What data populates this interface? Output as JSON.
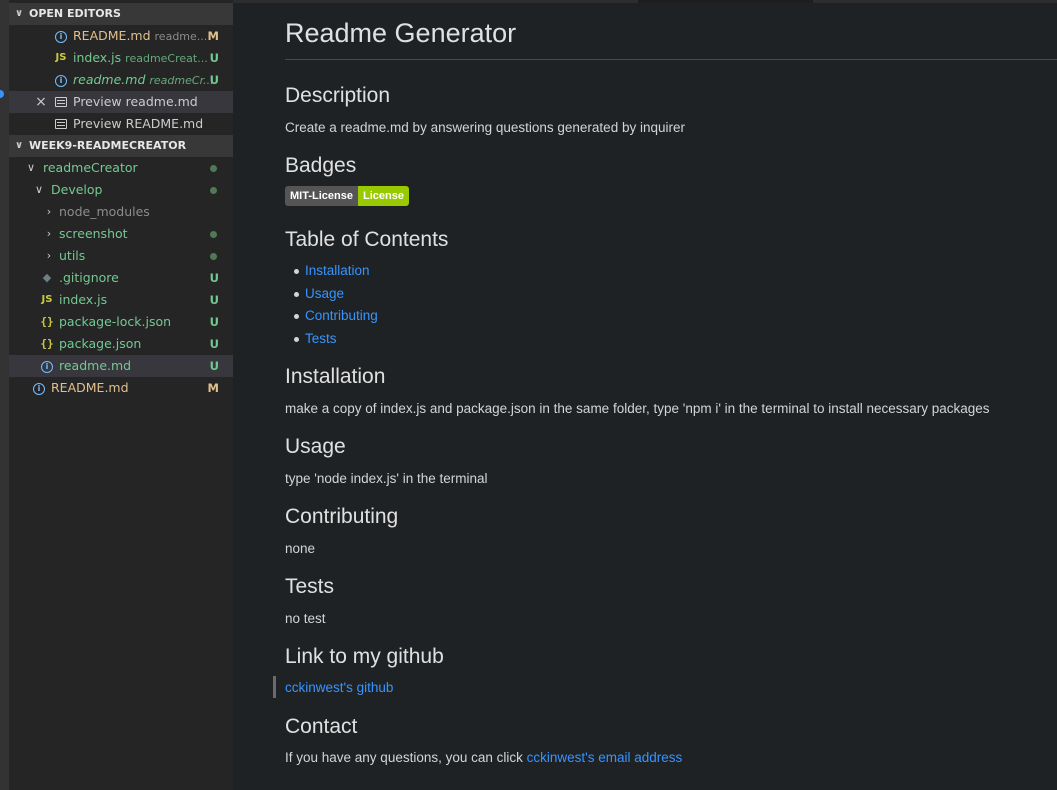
{
  "sidebar": {
    "open_editors": {
      "title": "OPEN EDITORS",
      "items": [
        {
          "icon": "info-icon",
          "name": "README.md",
          "desc": "readme...",
          "badge": "M"
        },
        {
          "icon": "js-icon",
          "name": "index.js",
          "desc": "readmeCreat...",
          "badge": "U"
        },
        {
          "icon": "info-icon",
          "name": "readme.md",
          "desc": "readmeCr...",
          "badge": "U"
        },
        {
          "icon": "preview-icon",
          "name": "Preview readme.md",
          "close": "×"
        },
        {
          "icon": "preview-icon",
          "name": "Preview README.md"
        }
      ]
    },
    "explorer": {
      "title": "WEEK9-README CREATOR",
      "title_display": "WEEK9-READMECREATOR",
      "items": [
        {
          "type": "folder",
          "name": "readmeCreator",
          "state": "open"
        },
        {
          "type": "folder",
          "name": "Develop",
          "state": "open"
        },
        {
          "type": "folder",
          "name": "node_modules",
          "state": "closed"
        },
        {
          "type": "folder",
          "name": "screenshot",
          "state": "closed"
        },
        {
          "type": "folder",
          "name": "utils",
          "state": "closed"
        },
        {
          "type": "file",
          "name": ".gitignore",
          "icon": "git-icon",
          "badge": "U"
        },
        {
          "type": "file",
          "name": "index.js",
          "icon": "js-icon",
          "badge": "U"
        },
        {
          "type": "file",
          "name": "package-lock.json",
          "icon": "json-icon",
          "badge": "U"
        },
        {
          "type": "file",
          "name": "package.json",
          "icon": "json-icon",
          "badge": "U"
        },
        {
          "type": "file",
          "name": "readme.md",
          "icon": "info-icon",
          "badge": "U"
        },
        {
          "type": "file",
          "name": "README.md",
          "icon": "info-icon",
          "badge": "M"
        }
      ]
    }
  },
  "preview": {
    "title": "Readme Generator",
    "description_heading": "Description",
    "description_text": "Create a readme.md by answering questions generated by inquirer",
    "badges_heading": "Badges",
    "badge_left": "MIT-License",
    "badge_right": "License",
    "toc_heading": "Table of Contents",
    "toc": [
      "Installation",
      "Usage",
      "Contributing",
      "Tests"
    ],
    "installation_heading": "Installation",
    "installation_text": "make a copy of index.js and package.json in the same folder, type 'npm i' in the terminal to install necessary packages",
    "usage_heading": "Usage",
    "usage_text": "type 'node index.js' in the terminal",
    "contributing_heading": "Contributing",
    "contributing_text": "none",
    "tests_heading": "Tests",
    "tests_text": "no test",
    "github_heading": "Link to my github",
    "github_link": "cckinwest's github",
    "contact_heading": "Contact",
    "contact_text": "If you have any questions, you can click ",
    "contact_link": "cckinwest's email address"
  },
  "colors": {
    "modified": "#e2c08d",
    "untracked": "#73c991",
    "link": "#3794ff",
    "badge_green": "#97ca00"
  }
}
